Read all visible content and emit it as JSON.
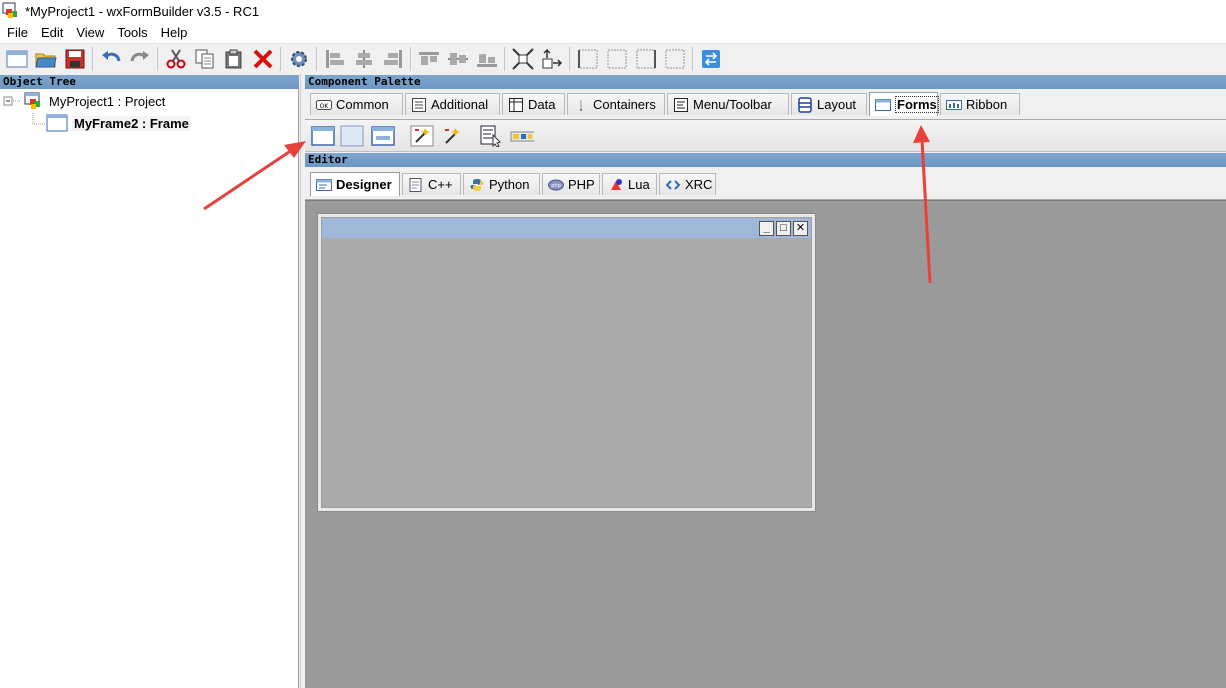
{
  "window": {
    "title": "*MyProject1 - wxFormBuilder v3.5 - RC1"
  },
  "menu": [
    "File",
    "Edit",
    "View",
    "Tools",
    "Help"
  ],
  "toolbar_icons": [
    "new-icon",
    "open-icon",
    "save-icon",
    "undo-icon",
    "redo-icon",
    "cut-icon",
    "copy-icon",
    "paste-icon",
    "delete-icon",
    "generate-code-icon",
    "align-left-icon",
    "align-center-h-icon",
    "align-right-icon",
    "align-top-icon",
    "align-center-v-icon",
    "align-bottom-icon",
    "expand-icon",
    "stretch-icon",
    "border-left-icon",
    "border-right-icon",
    "border-top-icon",
    "border-bottom-icon",
    "swap-icon"
  ],
  "object_tree": {
    "header": "Object Tree",
    "project": "MyProject1 : Project",
    "frame": "MyFrame2 : Frame"
  },
  "palette": {
    "header": "Component Palette",
    "tabs": [
      "Common",
      "Additional",
      "Data",
      "Containers",
      "Menu/Toolbar",
      "Layout",
      "Forms",
      "Ribbon"
    ],
    "active_tab": "Forms",
    "form_icons": [
      "frame-icon",
      "panel-icon",
      "dialog-icon",
      "wizard-icon",
      "wizard-page-icon",
      "menubar-form-icon",
      "toolbar-form-icon"
    ]
  },
  "editor": {
    "header": "Editor",
    "tabs": [
      "Designer",
      "C++",
      "Python",
      "PHP",
      "Lua",
      "XRC"
    ],
    "active_tab": "Designer",
    "frame_buttons": [
      "_",
      "□",
      "✕"
    ]
  },
  "colors": {
    "panel_header": "#7ea6cc",
    "annotation_arrow": "#e8413c",
    "editor_bg": "#9a9a9a"
  }
}
